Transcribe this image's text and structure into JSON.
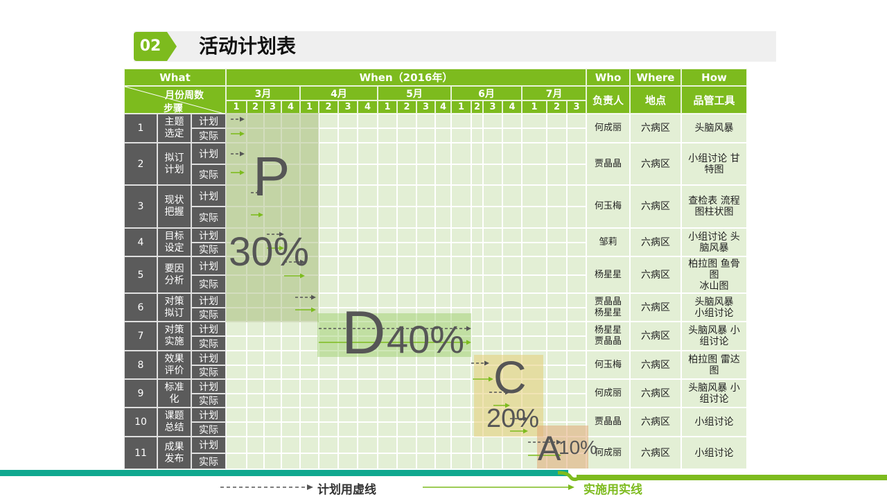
{
  "section": {
    "number": "02",
    "title": "活动计划表"
  },
  "header": {
    "what": "What",
    "when": "When（2016年）",
    "who": "Who",
    "where": "Where",
    "how": "How",
    "month_week": "月份周数",
    "step": "步骤",
    "person": "负责人",
    "place": "地点",
    "tool": "品管工具"
  },
  "months": [
    {
      "label": "3月",
      "weeks": [
        "1",
        "2",
        "3",
        "4"
      ]
    },
    {
      "label": "4月",
      "weeks": [
        "1",
        "2",
        "3",
        "4"
      ]
    },
    {
      "label": "5月",
      "weeks": [
        "1",
        "2",
        "3",
        "4"
      ]
    },
    {
      "label": "6月",
      "weeks": [
        "1",
        "2",
        "3",
        "4"
      ]
    },
    {
      "label": "7月",
      "weeks": [
        "1",
        "2",
        "3"
      ]
    }
  ],
  "kinds": {
    "plan": "计划",
    "actual": "实际"
  },
  "rows": [
    {
      "num": "1",
      "step": "主题\n选定",
      "person": "何成丽",
      "place": "六病区",
      "tool": "头脑风暴"
    },
    {
      "num": "2",
      "step": "拟订\n计划",
      "person": "贾晶晶",
      "place": "六病区",
      "tool": "小组讨论 甘\n特图"
    },
    {
      "num": "3",
      "step": "现状\n把握",
      "person": "何玉梅",
      "place": "六病区",
      "tool": "查检表 流程\n图柱状图"
    },
    {
      "num": "4",
      "step": "目标\n设定",
      "person": "邹莉",
      "place": "六病区",
      "tool": "小组讨论  头\n脑风暴"
    },
    {
      "num": "5",
      "step": "要因\n分析",
      "person": "杨星星",
      "place": "六病区",
      "tool": "柏拉图 鱼骨\n图\n冰山图"
    },
    {
      "num": "6",
      "step": "对策\n拟订",
      "person": "贾晶晶\n杨星星",
      "place": "六病区",
      "tool": "头脑风暴\n小组讨论"
    },
    {
      "num": "7",
      "step": "对策\n实施",
      "person": "杨星星\n贾晶晶",
      "place": "六病区",
      "tool": "头脑风暴  小\n组讨论"
    },
    {
      "num": "8",
      "step": "效果\n评价",
      "person": "何玉梅",
      "place": "六病区",
      "tool": "柏拉图 雷达\n图"
    },
    {
      "num": "9",
      "step": "标准\n化",
      "person": "何成丽",
      "place": "六病区",
      "tool": "头脑风暴 小\n组讨论"
    },
    {
      "num": "10",
      "step": "课题\n总结",
      "person": "贾晶晶",
      "place": "六病区",
      "tool": "小组讨论"
    },
    {
      "num": "11",
      "step": "成果\n发布",
      "person": "何成丽",
      "place": "六病区",
      "tool": "小组讨论"
    }
  ],
  "phases": [
    {
      "letter": "P",
      "percent": "30%",
      "color": "#8fa85a"
    },
    {
      "letter": "D",
      "percent": "40%",
      "color": "#8fcc5a"
    },
    {
      "letter": "C",
      "percent": "20%",
      "color": "#e3c86e"
    },
    {
      "letter": "A",
      "percent": "10%",
      "color": "#dda56e"
    }
  ],
  "legend": {
    "dashed": "计划用虚线",
    "solid": "实施用实线"
  },
  "colors": {
    "green": "#7dbb1e",
    "dark": "#5b5b5b",
    "light": "#e3efd5",
    "teal": "#10a88f",
    "plan_arrow": "#555555",
    "actual_arrow": "#7dbb1e"
  }
}
